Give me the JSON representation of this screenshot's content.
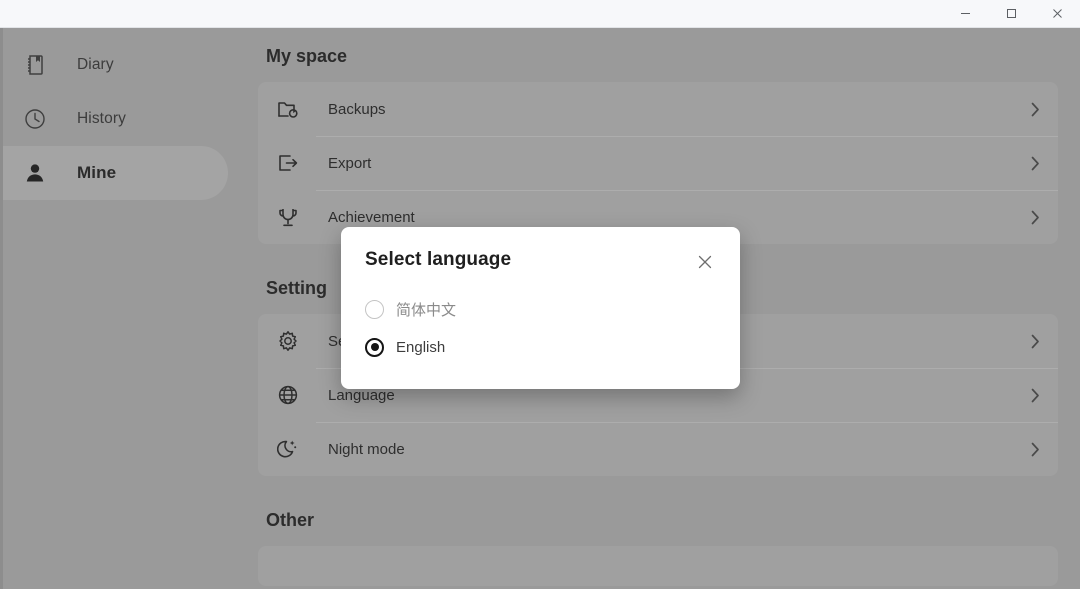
{
  "window": {
    "controls": [
      {
        "name": "minimize-button",
        "label": "─",
        "icon": "minimize-icon"
      },
      {
        "name": "maximize-button",
        "label": "□",
        "icon": "maximize-icon"
      },
      {
        "name": "close-button",
        "label": "✕",
        "icon": "close-icon"
      }
    ]
  },
  "sidebar": {
    "items": [
      {
        "label": "Diary",
        "icon": "notebook-icon",
        "active": false
      },
      {
        "label": "History",
        "icon": "clock-icon",
        "active": false
      },
      {
        "label": "Mine",
        "icon": "person-icon",
        "active": true
      }
    ]
  },
  "main": {
    "sections": [
      {
        "title": "My space",
        "rows": [
          {
            "label": "Backups",
            "icon": "folder-sync-icon",
            "chevron": "chevron-right-icon"
          },
          {
            "label": "Export",
            "icon": "export-icon",
            "chevron": "chevron-right-icon"
          },
          {
            "label": "Achievement",
            "icon": "trophy-icon",
            "chevron": "chevron-right-icon"
          }
        ]
      },
      {
        "title": "Setting",
        "rows": [
          {
            "label": "Se",
            "icon": "gear-icon",
            "chevron": "chevron-right-icon"
          },
          {
            "label": "Language",
            "icon": "globe-icon",
            "chevron": "chevron-right-icon"
          },
          {
            "label": "Night mode",
            "icon": "moon-stars-icon",
            "chevron": "chevron-right-icon"
          }
        ]
      },
      {
        "title": "Other",
        "rows": []
      }
    ]
  },
  "dialog": {
    "title": "Select language",
    "close_icon": "close-icon",
    "options": [
      {
        "label": "简体中文",
        "selected": false
      },
      {
        "label": "English",
        "selected": true
      }
    ]
  },
  "colors": {
    "page_bg": "#9a9a9a",
    "card_bg": "#a0a0a0",
    "sidebar_active": "#a4a4a4",
    "titlebar_bg": "#f7f8fa",
    "dialog_bg": "#ffffff",
    "text_primary": "#2c2c2c",
    "text_muted": "#8a8a8a"
  }
}
